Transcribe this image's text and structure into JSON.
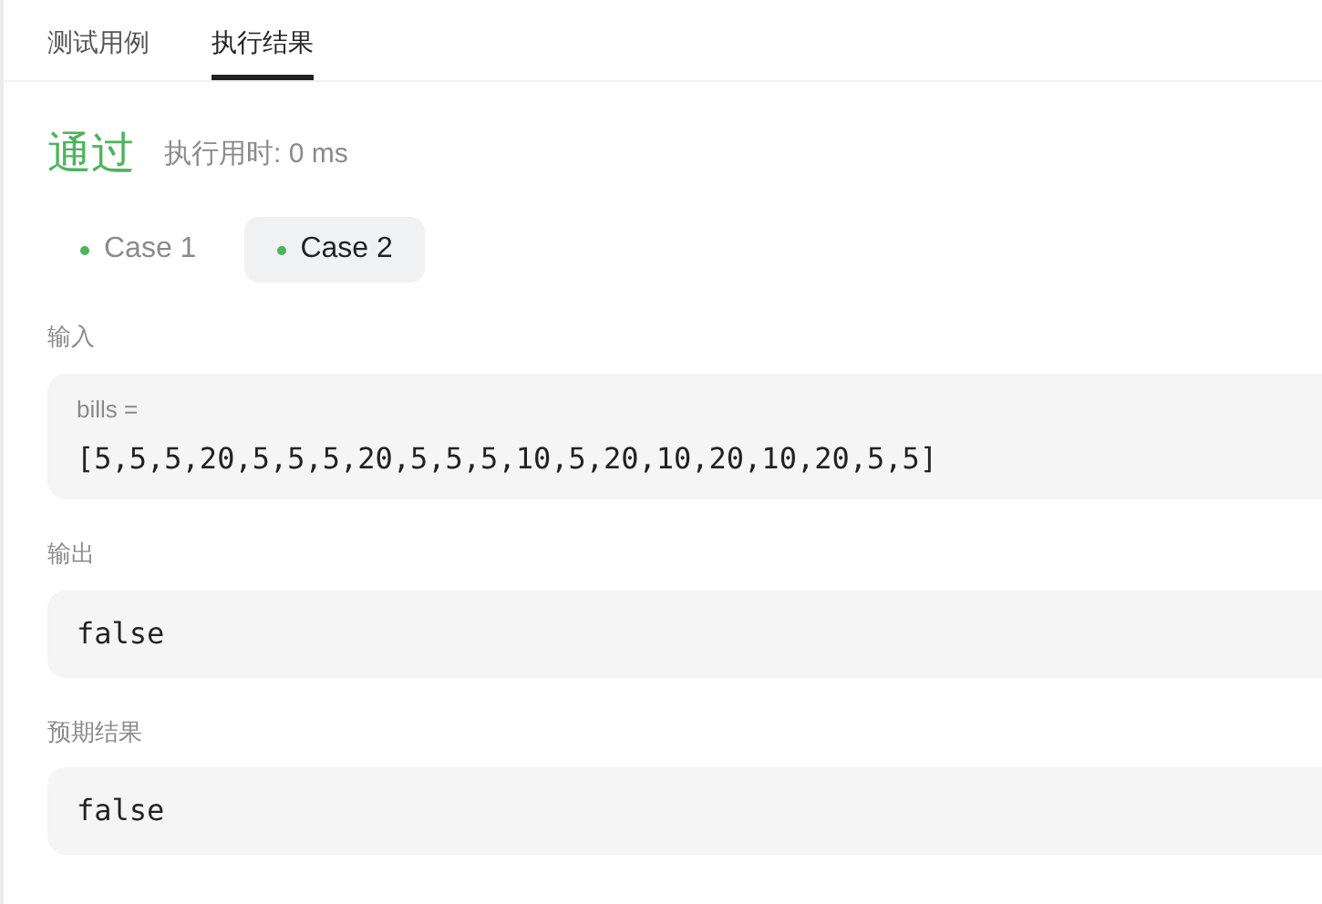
{
  "tabs": [
    {
      "label": "测试用例",
      "selected": false
    },
    {
      "label": "执行结果",
      "selected": true
    }
  ],
  "result": {
    "status": "通过",
    "kind": "accepted",
    "runtime": "执行用时: 0 ms"
  },
  "cases": [
    {
      "label": "Case 1",
      "passed": true,
      "selected": false
    },
    {
      "label": "Case 2",
      "passed": true,
      "selected": true
    }
  ],
  "input": {
    "label": "输入",
    "variables": [
      {
        "name": "bills =",
        "value": "[5,5,5,20,5,5,5,20,5,5,5,10,5,20,10,20,10,20,5,5]"
      }
    ]
  },
  "output": {
    "label": "输出",
    "value": "false"
  },
  "expected": {
    "label": "预期结果",
    "value": "false"
  }
}
